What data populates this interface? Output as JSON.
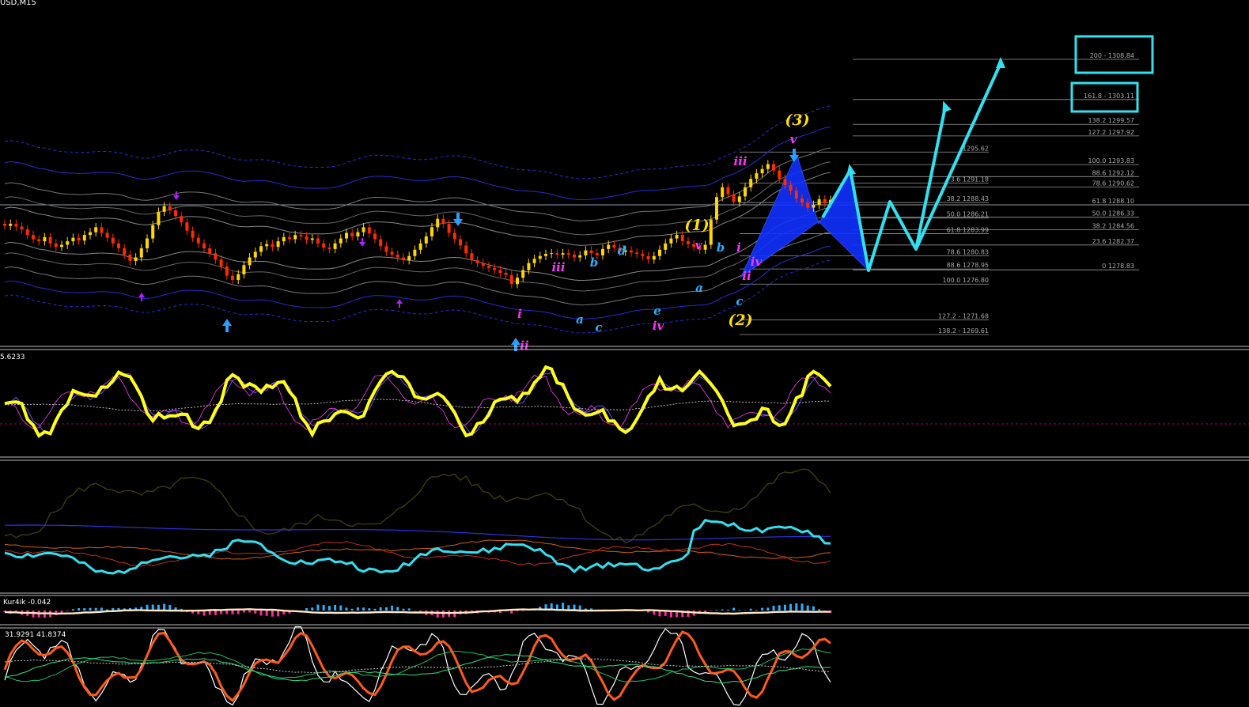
{
  "symbol_label": "USD,M15",
  "panes": {
    "rsi_value": "5.6233",
    "osc_label": "Kur4ik -0.042",
    "stoch_label": "31.9291 41.8374"
  },
  "colors": {
    "background": "#000000",
    "bull_candle": "#ffd700",
    "bear_candle": "#ff2a00",
    "pattern_fill": "#1030ff",
    "projection": "#33e0f0",
    "fib_line": "#9a9a9a",
    "wave_main": "#ffe000",
    "wave_minor": "#ff33ff",
    "wave_sub": "#2ab0ff",
    "channel": "#2a2ad0",
    "arrow_up": "#2a9dff",
    "arrow_down": "#b020ff"
  },
  "wave_labels": [
    {
      "text": "(3)",
      "kind": "main"
    },
    {
      "text": "(1)",
      "kind": "main"
    },
    {
      "text": "(2)",
      "kind": "main"
    },
    {
      "text": "iii",
      "kind": "minor"
    },
    {
      "text": "v",
      "kind": "minor"
    },
    {
      "text": "iii",
      "kind": "minor"
    },
    {
      "text": "v",
      "kind": "minor"
    },
    {
      "text": "iv",
      "kind": "minor"
    },
    {
      "text": "ii",
      "kind": "minor"
    },
    {
      "text": "i",
      "kind": "minor"
    },
    {
      "text": "iv",
      "kind": "minor"
    },
    {
      "text": "i",
      "kind": "minor"
    },
    {
      "text": "ii",
      "kind": "minor"
    },
    {
      "text": "b",
      "kind": "sub"
    },
    {
      "text": "d",
      "kind": "sub"
    },
    {
      "text": "a",
      "kind": "sub"
    },
    {
      "text": "c",
      "kind": "sub"
    },
    {
      "text": "e",
      "kind": "sub"
    },
    {
      "text": "a",
      "kind": "sub"
    },
    {
      "text": "b",
      "kind": "sub"
    },
    {
      "text": "c",
      "kind": "sub"
    }
  ],
  "fib_levels": [
    {
      "label": "200 - 1308.84",
      "boxed": true
    },
    {
      "label": "161.8 - 1303.11",
      "boxed": true
    },
    {
      "label": "138.2 1299.57",
      "boxed": false
    },
    {
      "label": "127.2 1297.92",
      "boxed": false
    },
    {
      "label": "100.0 1293.83",
      "boxed": false
    },
    {
      "label": "88.6 1292.12",
      "boxed": false
    },
    {
      "label": "78.6 1290.62",
      "boxed": false
    },
    {
      "label": "61.8 1288.10",
      "boxed": false
    },
    {
      "label": "50.0 1286.33",
      "boxed": false
    },
    {
      "label": "38.2 1284.56",
      "boxed": false
    },
    {
      "label": "23.6 1282.37",
      "boxed": false
    },
    {
      "label": "0 1278.83",
      "boxed": false
    },
    {
      "label": "1295.62",
      "boxed": false
    },
    {
      "label": "3.6 1291.18",
      "boxed": false
    },
    {
      "label": "38.2 1288.43",
      "boxed": false
    },
    {
      "label": "50.0 1286.21",
      "boxed": false
    },
    {
      "label": "61.8 1283.99",
      "boxed": false
    },
    {
      "label": "78.6 1280.83",
      "boxed": false
    },
    {
      "label": "88.6 1278.95",
      "boxed": false
    },
    {
      "label": "100.0 1276.80",
      "boxed": false
    },
    {
      "label": "127.2 - 1271.68",
      "boxed": false
    },
    {
      "label": "138.2 - 1269.61",
      "boxed": false
    }
  ],
  "chart_data": {
    "type": "candlestick",
    "timeframe": "M15",
    "y_range": [
      1269,
      1310
    ],
    "close_series": [
      1285.1,
      1285.4,
      1285.0,
      1284.6,
      1283.8,
      1283.2,
      1282.9,
      1283.5,
      1282.6,
      1282.1,
      1282.4,
      1282.9,
      1283.4,
      1283.0,
      1283.8,
      1284.2,
      1284.9,
      1284.1,
      1283.4,
      1282.6,
      1281.9,
      1281.0,
      1280.1,
      1280.6,
      1281.9,
      1283.3,
      1285.2,
      1287.1,
      1287.9,
      1287.3,
      1286.5,
      1285.6,
      1284.4,
      1283.4,
      1282.6,
      1281.9,
      1281.2,
      1280.3,
      1279.3,
      1278.0,
      1277.4,
      1278.2,
      1279.5,
      1280.6,
      1281.4,
      1282.2,
      1282.5,
      1282.1,
      1282.9,
      1283.5,
      1283.2,
      1283.8,
      1283.6,
      1283.1,
      1283.3,
      1282.6,
      1282.0,
      1281.8,
      1282.6,
      1283.3,
      1284.1,
      1283.6,
      1284.2,
      1284.9,
      1284.0,
      1283.2,
      1282.2,
      1281.4,
      1281.0,
      1280.6,
      1280.2,
      1280.8,
      1281.7,
      1282.6,
      1283.6,
      1284.9,
      1286.1,
      1285.4,
      1284.1,
      1283.2,
      1282.3,
      1281.2,
      1280.2,
      1279.8,
      1279.4,
      1279.1,
      1278.8,
      1278.4,
      1278.1,
      1276.8,
      1277.7,
      1278.8,
      1279.8,
      1280.4,
      1280.8,
      1281.1,
      1281.2,
      1281.0,
      1281.2,
      1281.0,
      1280.6,
      1280.9,
      1281.6,
      1281.2,
      1280.9,
      1281.8,
      1282.4,
      1282.0,
      1281.4,
      1281.6,
      1281.3,
      1281.1,
      1280.8,
      1280.3,
      1280.8,
      1281.7,
      1282.6,
      1283.3,
      1283.8,
      1282.9,
      1282.5,
      1282.1,
      1281.7,
      1282.4,
      1286.0,
      1289.2,
      1290.6,
      1289.6,
      1288.5,
      1289.3,
      1290.6,
      1291.8,
      1292.6,
      1293.2,
      1293.9,
      1293.0,
      1291.8,
      1290.9,
      1290.1,
      1289.0,
      1288.4,
      1287.7,
      1288.1,
      1288.9,
      1288.3,
      1288.8
    ]
  }
}
